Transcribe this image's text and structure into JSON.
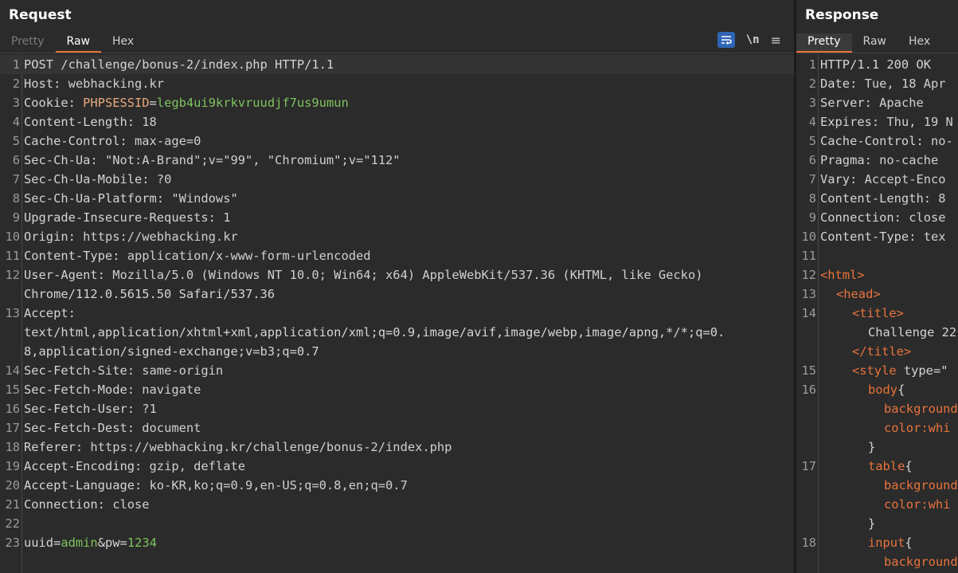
{
  "request": {
    "title": "Request",
    "tabs": [
      "Pretty",
      "Raw",
      "Hex"
    ],
    "active_tab": "Raw",
    "icons": {
      "wrap": "wrap-lines-icon",
      "newline": "\\n",
      "menu": "≡"
    },
    "lines": [
      {
        "n": "1",
        "name": "POST /challenge/bonus-2/index.php HTTP/1.1",
        "value": ""
      },
      {
        "n": "2",
        "name": "Host:",
        "value": " webhacking.kr"
      },
      {
        "n": "3",
        "name": "Cookie:",
        "ck": " PHPSESSID",
        "eq": "=",
        "cv": "legb4ui9krkvruudjf7us9umun"
      },
      {
        "n": "4",
        "name": "Content-Length:",
        "value": " 18"
      },
      {
        "n": "5",
        "name": "Cache-Control:",
        "value": " max-age=0"
      },
      {
        "n": "6",
        "name": "Sec-Ch-Ua:",
        "value": " \"Not:A-Brand\";v=\"99\", \"Chromium\";v=\"112\""
      },
      {
        "n": "7",
        "name": "Sec-Ch-Ua-Mobile:",
        "value": " ?0"
      },
      {
        "n": "8",
        "name": "Sec-Ch-Ua-Platform:",
        "value": " \"Windows\""
      },
      {
        "n": "9",
        "name": "Upgrade-Insecure-Requests:",
        "value": " 1"
      },
      {
        "n": "10",
        "name": "Origin:",
        "value": " https://webhacking.kr"
      },
      {
        "n": "11",
        "name": "Content-Type:",
        "value": " application/x-www-form-urlencoded"
      },
      {
        "n": "12",
        "name": "User-Agent:",
        "value": " Mozilla/5.0 (Windows NT 10.0; Win64; x64) AppleWebKit/537.36 (KHTML, like Gecko)",
        "cont": [
          "Chrome/112.0.5615.50 Safari/537.36"
        ]
      },
      {
        "n": "13",
        "name": "Accept:",
        "value": "",
        "cont": [
          "text/html,application/xhtml+xml,application/xml;q=0.9,image/avif,image/webp,image/apng,*/*;q=0.",
          "8,application/signed-exchange;v=b3;q=0.7"
        ]
      },
      {
        "n": "14",
        "name": "Sec-Fetch-Site:",
        "value": " same-origin"
      },
      {
        "n": "15",
        "name": "Sec-Fetch-Mode:",
        "value": " navigate"
      },
      {
        "n": "16",
        "name": "Sec-Fetch-User:",
        "value": " ?1"
      },
      {
        "n": "17",
        "name": "Sec-Fetch-Dest:",
        "value": " document"
      },
      {
        "n": "18",
        "name": "Referer:",
        "value": " https://webhacking.kr/challenge/bonus-2/index.php"
      },
      {
        "n": "19",
        "name": "Accept-Encoding:",
        "value": " gzip, deflate"
      },
      {
        "n": "20",
        "name": "Accept-Language:",
        "value": " ko-KR,ko;q=0.9,en-US;q=0.8,en;q=0.7"
      },
      {
        "n": "21",
        "name": "Connection:",
        "value": " close"
      },
      {
        "n": "22",
        "name": "",
        "value": ""
      },
      {
        "n": "23",
        "body": [
          {
            "t": "uuid",
            "c": "pk"
          },
          {
            "t": "=",
            "c": "pk"
          },
          {
            "t": "admin",
            "c": "pv"
          },
          {
            "t": "&pw",
            "c": "pk"
          },
          {
            "t": "=",
            "c": "pk"
          },
          {
            "t": "1234",
            "c": "pv"
          }
        ]
      }
    ]
  },
  "response": {
    "title": "Response",
    "tabs": [
      "Pretty",
      "Raw",
      "Hex"
    ],
    "active_tab": "Pretty",
    "lines": [
      {
        "n": "1",
        "text": "HTTP/1.1 200 OK"
      },
      {
        "n": "2",
        "name": "Date:",
        "value": " Tue, 18 Apr"
      },
      {
        "n": "3",
        "name": "Server:",
        "value": " Apache"
      },
      {
        "n": "4",
        "name": "Expires:",
        "value": " Thu, 19 N"
      },
      {
        "n": "5",
        "name": "Cache-Control:",
        "value": " no-"
      },
      {
        "n": "6",
        "name": "Pragma:",
        "value": " no-cache"
      },
      {
        "n": "7",
        "name": "Vary:",
        "value": " Accept-Enco"
      },
      {
        "n": "8",
        "name": "Content-Length:",
        "value": " 8"
      },
      {
        "n": "9",
        "name": "Connection:",
        "value": " close"
      },
      {
        "n": "10",
        "name": "Content-Type:",
        "value": " tex"
      },
      {
        "n": "11",
        "text": ""
      },
      {
        "n": "12",
        "html": [
          {
            "t": "<html>",
            "c": "tag"
          }
        ]
      },
      {
        "n": "13",
        "indent": 1,
        "html": [
          {
            "t": "<head>",
            "c": "tag"
          }
        ]
      },
      {
        "n": "14",
        "indent": 2,
        "html": [
          {
            "t": "<title>",
            "c": "tag"
          }
        ]
      },
      {
        "n": "",
        "indent": 3,
        "html": [
          {
            "t": "Challenge 22",
            "c": ""
          }
        ]
      },
      {
        "n": "",
        "indent": 2,
        "html": [
          {
            "t": "</title>",
            "c": "tag"
          }
        ]
      },
      {
        "n": "15",
        "indent": 2,
        "html": [
          {
            "t": "<style ",
            "c": "tag"
          },
          {
            "t": "type=\"",
            "c": ""
          }
        ]
      },
      {
        "n": "16",
        "indent": 3,
        "html": [
          {
            "t": "body",
            "c": "css"
          },
          {
            "t": "{",
            "c": ""
          }
        ]
      },
      {
        "n": "",
        "indent": 4,
        "html": [
          {
            "t": "background",
            "c": "css"
          }
        ]
      },
      {
        "n": "",
        "indent": 4,
        "html": [
          {
            "t": "color:whi",
            "c": "css"
          }
        ]
      },
      {
        "n": "",
        "indent": 3,
        "html": [
          {
            "t": "}",
            "c": ""
          }
        ]
      },
      {
        "n": "17",
        "indent": 3,
        "html": [
          {
            "t": "table",
            "c": "css"
          },
          {
            "t": "{",
            "c": ""
          }
        ]
      },
      {
        "n": "",
        "indent": 4,
        "html": [
          {
            "t": "background",
            "c": "css"
          }
        ]
      },
      {
        "n": "",
        "indent": 4,
        "html": [
          {
            "t": "color:whi",
            "c": "css"
          }
        ]
      },
      {
        "n": "",
        "indent": 3,
        "html": [
          {
            "t": "}",
            "c": ""
          }
        ]
      },
      {
        "n": "18",
        "indent": 3,
        "html": [
          {
            "t": "input",
            "c": "css"
          },
          {
            "t": "{",
            "c": ""
          }
        ]
      },
      {
        "n": "",
        "indent": 4,
        "html": [
          {
            "t": "background",
            "c": "css"
          }
        ]
      }
    ]
  }
}
